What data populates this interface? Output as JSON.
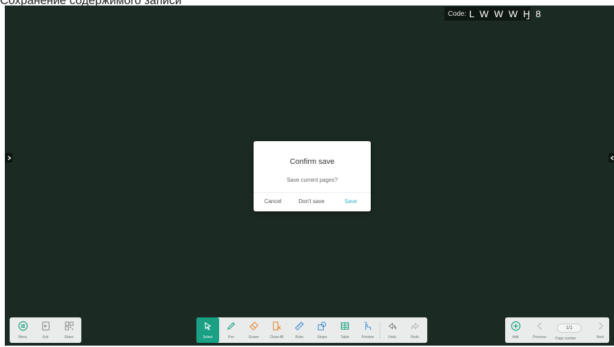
{
  "caption": "Сохранение содержимого записи",
  "code": {
    "label": "Code:",
    "value": "L W W W H 8"
  },
  "dialog": {
    "title": "Confirm save",
    "message": "Save current pages?",
    "buttons": {
      "cancel": "Cancel",
      "dont_save": "Don't save",
      "save": "Save"
    }
  },
  "left_toolbar": [
    {
      "icon": "menu-icon",
      "label": "Menu"
    },
    {
      "icon": "exit-icon",
      "label": "Exit"
    },
    {
      "icon": "qr-share-icon",
      "label": "Share"
    }
  ],
  "main_toolbar": [
    {
      "icon": "select-cursor-icon",
      "label": "Select",
      "active": true
    },
    {
      "icon": "pen-icon",
      "label": "Pen"
    },
    {
      "icon": "eraser-icon",
      "label": "Eraser"
    },
    {
      "icon": "clean-all-icon",
      "label": "Clean All"
    },
    {
      "icon": "ruler-icon",
      "label": "Ruler"
    },
    {
      "icon": "shape-icon",
      "label": "Shape"
    },
    {
      "icon": "table-icon",
      "label": "Table"
    },
    {
      "icon": "preview-icon",
      "label": "Preview"
    },
    {
      "icon": "undo-icon",
      "label": "Undo"
    },
    {
      "icon": "redo-icon",
      "label": "Redo"
    }
  ],
  "right_toolbar": {
    "add": "Add",
    "previous": "Previous",
    "page": "1/1",
    "page_label": "Page number",
    "next": "Next"
  },
  "colors": {
    "board": "#1b2b23",
    "accent": "#1aa083",
    "dialog_save": "#2ab2c2",
    "icon_orange": "#e4893a"
  }
}
